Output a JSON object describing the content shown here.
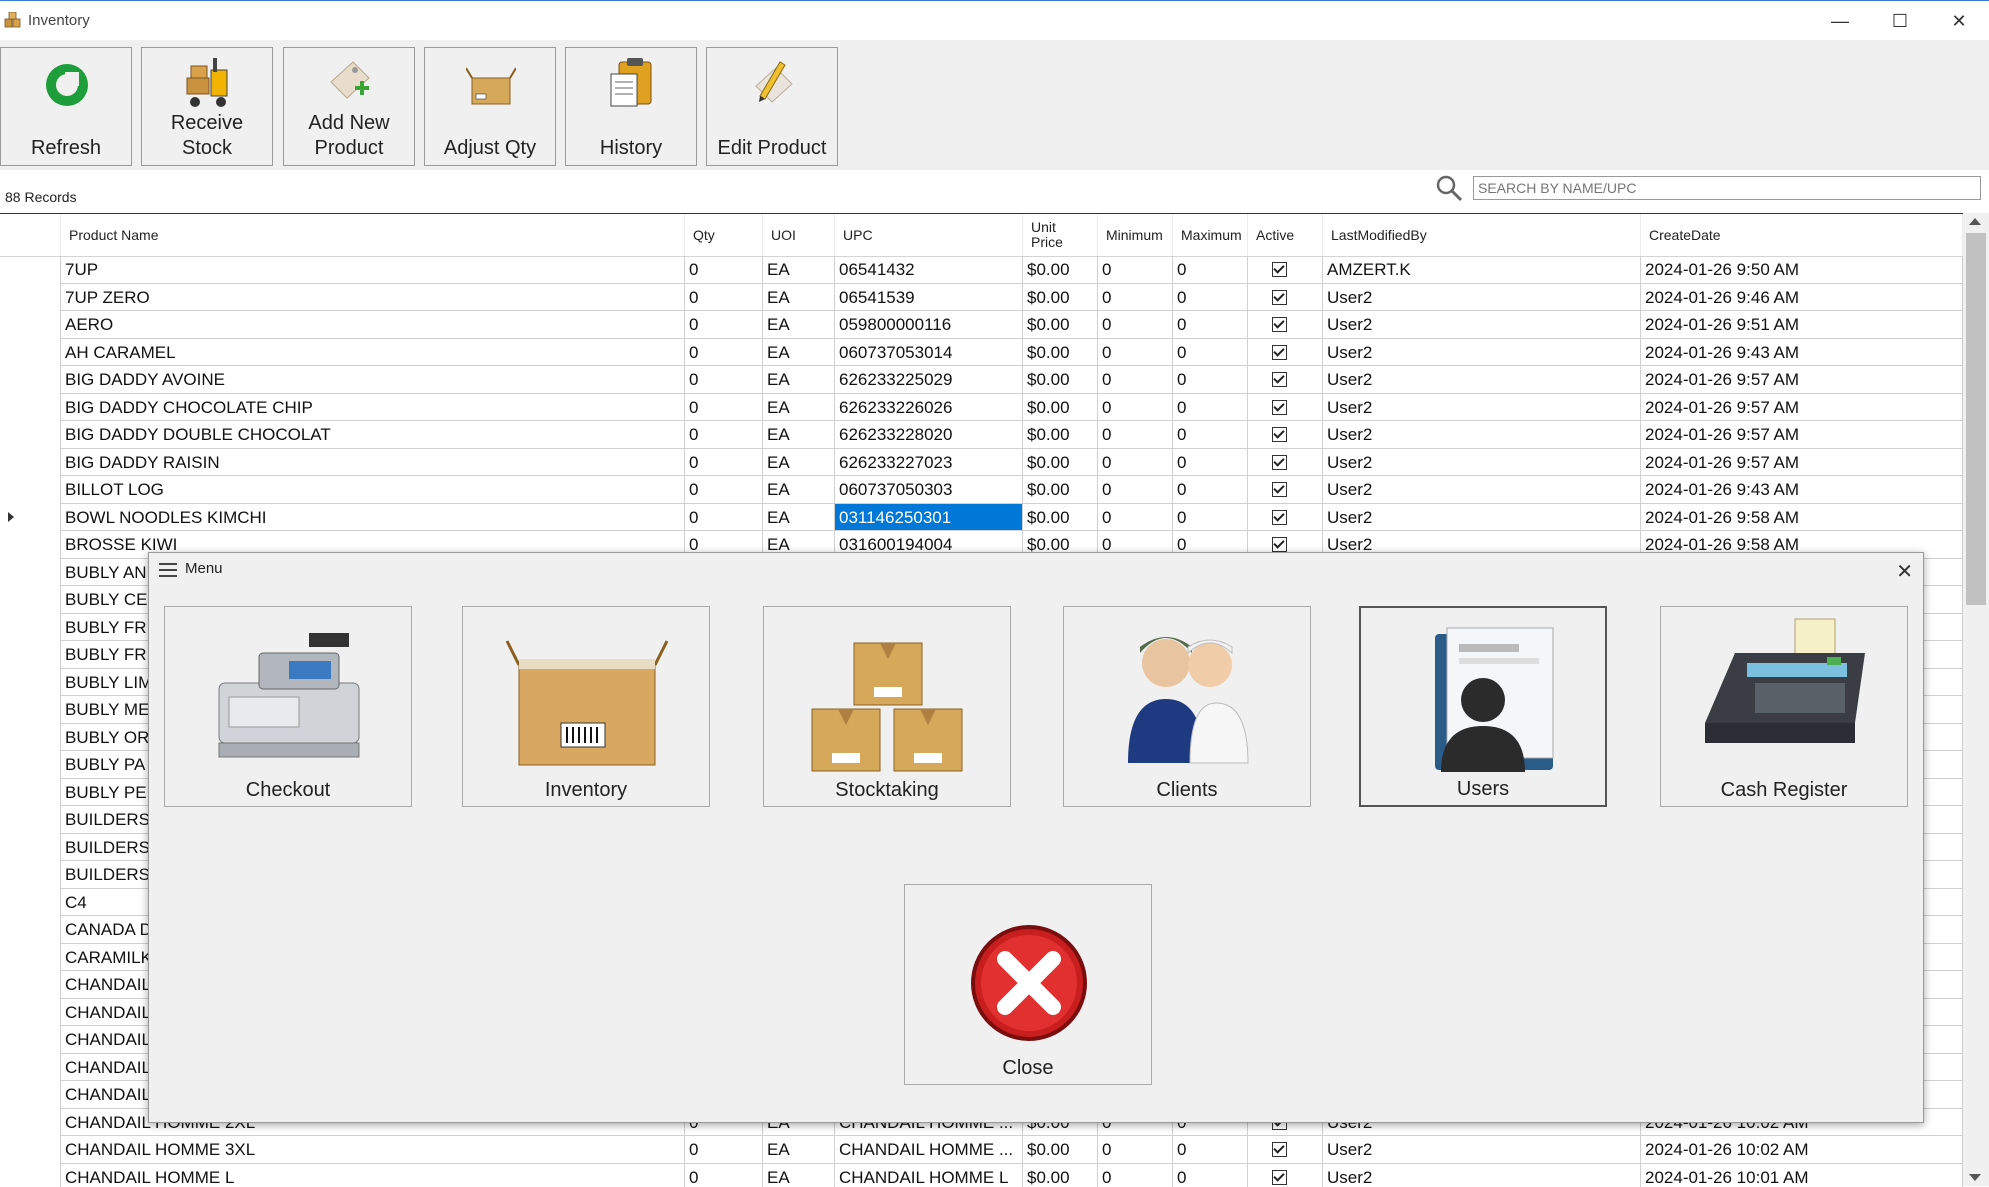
{
  "window": {
    "title": "Inventory"
  },
  "toolbar": {
    "buttons": [
      {
        "label": "Refresh",
        "icon": "refresh-icon"
      },
      {
        "label": "Receive\nStock",
        "icon": "forklift-icon"
      },
      {
        "label": "Add New\nProduct",
        "icon": "add-product-icon"
      },
      {
        "label": "Adjust Qty",
        "icon": "box-icon"
      },
      {
        "label": "History",
        "icon": "clipboard-icon"
      },
      {
        "label": "Edit Product",
        "icon": "pencil-icon"
      }
    ]
  },
  "records_label": "88 Records",
  "search": {
    "placeholder": "SEARCH BY NAME/UPC"
  },
  "grid": {
    "columns": [
      "Product Name",
      "Qty",
      "UOI",
      "UPC",
      "Unit\nPrice",
      "Minimum",
      "Maximum",
      "Active",
      "LastModifiedBy",
      "CreateDate"
    ],
    "rows": [
      [
        "7UP",
        "0",
        "EA",
        "06541432",
        "$0.00",
        "0",
        "0",
        true,
        "AMZERT.K",
        "2024-01-26 9:50 AM"
      ],
      [
        "7UP ZERO",
        "0",
        "EA",
        "06541539",
        "$0.00",
        "0",
        "0",
        true,
        "User2",
        "2024-01-26 9:46 AM"
      ],
      [
        "AERO",
        "0",
        "EA",
        "059800000116",
        "$0.00",
        "0",
        "0",
        true,
        "User2",
        "2024-01-26 9:51 AM"
      ],
      [
        "AH CARAMEL",
        "0",
        "EA",
        "060737053014",
        "$0.00",
        "0",
        "0",
        true,
        "User2",
        "2024-01-26 9:43 AM"
      ],
      [
        "BIG DADDY AVOINE",
        "0",
        "EA",
        "626233225029",
        "$0.00",
        "0",
        "0",
        true,
        "User2",
        "2024-01-26 9:57 AM"
      ],
      [
        "BIG DADDY CHOCOLATE CHIP",
        "0",
        "EA",
        "626233226026",
        "$0.00",
        "0",
        "0",
        true,
        "User2",
        "2024-01-26 9:57 AM"
      ],
      [
        "BIG DADDY DOUBLE CHOCOLAT",
        "0",
        "EA",
        "626233228020",
        "$0.00",
        "0",
        "0",
        true,
        "User2",
        "2024-01-26 9:57 AM"
      ],
      [
        "BIG DADDY RAISIN",
        "0",
        "EA",
        "626233227023",
        "$0.00",
        "0",
        "0",
        true,
        "User2",
        "2024-01-26 9:57 AM"
      ],
      [
        "BILLOT LOG",
        "0",
        "EA",
        "060737050303",
        "$0.00",
        "0",
        "0",
        true,
        "User2",
        "2024-01-26 9:43 AM"
      ],
      [
        "BOWL NOODLES KIMCHI",
        "0",
        "EA",
        "031146250301",
        "$0.00",
        "0",
        "0",
        true,
        "User2",
        "2024-01-26 9:58 AM"
      ],
      [
        "BROSSE KIWI",
        "0",
        "EA",
        "031600194004",
        "$0.00",
        "0",
        "0",
        true,
        "User2",
        "2024-01-26 9:58 AM"
      ],
      [
        "BUBLY AN",
        "",
        "",
        "",
        "",
        "",
        "",
        false,
        "",
        ""
      ],
      [
        "BUBLY CE",
        "",
        "",
        "",
        "",
        "",
        "",
        false,
        "",
        ""
      ],
      [
        "BUBLY FR",
        "",
        "",
        "",
        "",
        "",
        "",
        false,
        "",
        ""
      ],
      [
        "BUBLY FR",
        "",
        "",
        "",
        "",
        "",
        "",
        false,
        "",
        ""
      ],
      [
        "BUBLY LIM",
        "",
        "",
        "",
        "",
        "",
        "",
        false,
        "",
        ""
      ],
      [
        "BUBLY ME",
        "",
        "",
        "",
        "",
        "",
        "",
        false,
        "",
        ""
      ],
      [
        "BUBLY OR",
        "",
        "",
        "",
        "",
        "",
        "",
        false,
        "",
        ""
      ],
      [
        "BUBLY PA",
        "",
        "",
        "",
        "",
        "",
        "",
        false,
        "",
        ""
      ],
      [
        "BUBLY PE",
        "",
        "",
        "",
        "",
        "",
        "",
        false,
        "",
        ""
      ],
      [
        "BUILDERS",
        "",
        "",
        "",
        "",
        "",
        "",
        false,
        "",
        ""
      ],
      [
        "BUILDERS",
        "",
        "",
        "",
        "",
        "",
        "",
        false,
        "",
        ""
      ],
      [
        "BUILDERS",
        "",
        "",
        "",
        "",
        "",
        "",
        false,
        "",
        ""
      ],
      [
        "C4",
        "",
        "",
        "",
        "",
        "",
        "",
        false,
        "",
        ""
      ],
      [
        "CANADA D",
        "",
        "",
        "",
        "",
        "",
        "",
        false,
        "",
        ""
      ],
      [
        "CARAMILK",
        "",
        "",
        "",
        "",
        "",
        "",
        false,
        "",
        ""
      ],
      [
        "CHANDAIL",
        "",
        "",
        "",
        "",
        "",
        "",
        false,
        "",
        ""
      ],
      [
        "CHANDAIL",
        "",
        "",
        "",
        "",
        "",
        "",
        false,
        "",
        ""
      ],
      [
        "CHANDAIL",
        "",
        "",
        "",
        "",
        "",
        "",
        false,
        "",
        ""
      ],
      [
        "CHANDAIL",
        "",
        "",
        "",
        "",
        "",
        "",
        false,
        "",
        ""
      ],
      [
        "CHANDAIL",
        "",
        "",
        "",
        "",
        "",
        "",
        false,
        "",
        ""
      ],
      [
        "CHANDAIL HOMME 2XL",
        "0",
        "EA",
        "CHANDAIL HOMME ...",
        "$0.00",
        "0",
        "0",
        true,
        "User2",
        "2024-01-26 10:02 AM"
      ],
      [
        "CHANDAIL HOMME 3XL",
        "0",
        "EA",
        "CHANDAIL HOMME ...",
        "$0.00",
        "0",
        "0",
        true,
        "User2",
        "2024-01-26 10:02 AM"
      ],
      [
        "CHANDAIL HOMME L",
        "0",
        "EA",
        "CHANDAIL HOMME L",
        "$0.00",
        "0",
        "0",
        true,
        "User2",
        "2024-01-26 10:01 AM"
      ]
    ],
    "selected_row": 9
  },
  "menu": {
    "title": "Menu",
    "tiles": [
      {
        "label": "Checkout",
        "icon": "cash-register-icon"
      },
      {
        "label": "Inventory",
        "icon": "inventory-box-icon"
      },
      {
        "label": "Stocktaking",
        "icon": "stacked-boxes-icon"
      },
      {
        "label": "Clients",
        "icon": "clients-icon"
      },
      {
        "label": "Users",
        "icon": "users-icon"
      },
      {
        "label": "Cash Register",
        "icon": "payment-terminal-icon"
      }
    ],
    "close_label": "Close"
  }
}
